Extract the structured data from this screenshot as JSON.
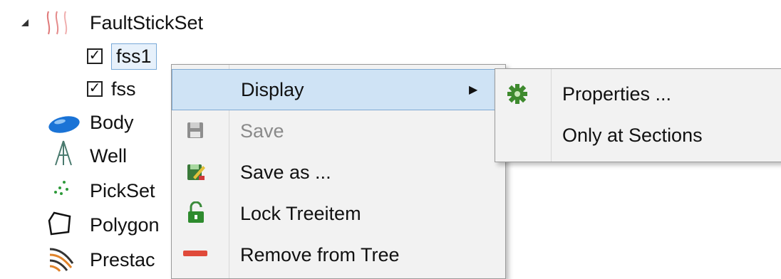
{
  "tree": {
    "root_label": "FaultStickSet",
    "children": [
      {
        "label": "fss1",
        "checked": "✓"
      },
      {
        "label": "fss",
        "checked": "✓"
      }
    ],
    "items": [
      "Body",
      "Well",
      "PickSet",
      "Polygon",
      "Prestac"
    ]
  },
  "context_menu": {
    "items": [
      {
        "label": "Display",
        "icon": "none",
        "submenu_arrow": "▶"
      },
      {
        "label": "Save",
        "icon": "floppy-disk-icon"
      },
      {
        "label": "Save as ...",
        "icon": "save-as-icon"
      },
      {
        "label": "Lock Treeitem",
        "icon": "padlock-open-icon"
      },
      {
        "label": "Remove from Tree",
        "icon": "red-bar-icon"
      }
    ]
  },
  "submenu": {
    "items": [
      {
        "label": "Properties ...",
        "icon": "gear-icon"
      },
      {
        "label": "Only at Sections",
        "icon": "none"
      }
    ]
  },
  "colors": {
    "highlight": "#cfe3f5",
    "highlight_border": "#7ea9d3",
    "menu_bg": "#f2f2f2"
  }
}
